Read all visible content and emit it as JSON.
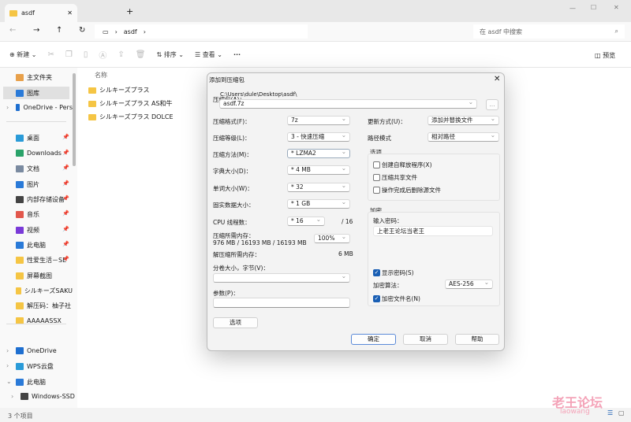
{
  "window": {
    "tab_title": "asdf",
    "new_tab": "+",
    "min": "—",
    "max": "☐",
    "close": "✕"
  },
  "address": {
    "crumb": "asdf",
    "search_placeholder": "在 asdf 中搜索"
  },
  "toolbar": {
    "new": "新建",
    "sort": "排序",
    "view": "查看",
    "more": "···",
    "preview": "预览"
  },
  "sidebar": {
    "items": [
      {
        "label": "主文件夹",
        "icon": "home-icon",
        "color": "#e8a04a"
      },
      {
        "label": "图库",
        "icon": "gallery-icon",
        "color": "#2a7ad8"
      },
      {
        "label": "OneDrive - Pers",
        "icon": "cloud-icon",
        "color": "#1e6fd0"
      },
      {
        "label": "桌面",
        "icon": "desktop-icon",
        "color": "#2a9bd8",
        "pin": true
      },
      {
        "label": "Downloads",
        "icon": "download-icon",
        "color": "#2aa36a",
        "pin": true
      },
      {
        "label": "文档",
        "icon": "document-icon",
        "color": "#7a8aa0",
        "pin": true
      },
      {
        "label": "图片",
        "icon": "picture-icon",
        "color": "#2a7ad8",
        "pin": true
      },
      {
        "label": "内部存储设备",
        "icon": "drive-icon",
        "color": "#444",
        "pin": true
      },
      {
        "label": "音乐",
        "icon": "music-icon",
        "color": "#e2574c",
        "pin": true
      },
      {
        "label": "视频",
        "icon": "video-icon",
        "color": "#7a3ad8",
        "pin": true
      },
      {
        "label": "此电脑",
        "icon": "computer-icon",
        "color": "#2a7ad8",
        "pin": true
      },
      {
        "label": "性爱生活－SE",
        "icon": "folder-icon",
        "color": "#f5c544",
        "pin": true
      },
      {
        "label": "屏幕截图",
        "icon": "folder-icon",
        "color": "#f5c544"
      },
      {
        "label": "シルキーズSAKU",
        "icon": "folder-icon",
        "color": "#f5c544"
      },
      {
        "label": "解压码：柚子社",
        "icon": "folder-icon",
        "color": "#f5c544"
      },
      {
        "label": "AAAAASSX",
        "icon": "folder-icon",
        "color": "#f5c544"
      },
      {
        "label": "OneDrive",
        "icon": "cloud-icon",
        "color": "#1e6fd0"
      },
      {
        "label": "WPS云盘",
        "icon": "cloud-icon",
        "color": "#2a9bd8"
      },
      {
        "label": "此电脑",
        "icon": "computer-icon",
        "color": "#2a7ad8"
      },
      {
        "label": "Windows-SSD",
        "icon": "drive-icon",
        "color": "#444"
      }
    ]
  },
  "files": {
    "header": "名称",
    "items": [
      "シルキーズプラス",
      "シルキーズプラス AS和牛",
      "シルキーズプラス DOLCE"
    ]
  },
  "status": "3 个项目",
  "dialog": {
    "title": "添加到压缩包",
    "close": "✕",
    "archive_label": "压缩包(A)：",
    "archive_path": "C:\\Users\\dule\\Desktop\\asdf\\",
    "archive_name": "asdf.7z",
    "browse": "...",
    "left": [
      {
        "label": "压缩格式(F)：",
        "value": "7z"
      },
      {
        "label": "压缩等级(L)：",
        "value": "3 - 快速压缩"
      },
      {
        "label": "压缩方法(M)：",
        "value": "* LZMA2"
      },
      {
        "label": "字典大小(D)：",
        "value": "* 4 MB"
      },
      {
        "label": "单词大小(W)：",
        "value": "* 32"
      },
      {
        "label": "固实数据大小：",
        "value": "* 1 GB"
      }
    ],
    "cpu": {
      "label": "CPU 线程数：",
      "value": "* 16",
      "max": "/ 16"
    },
    "mem": {
      "label": "压缩所需内存：",
      "detail": "976 MB / 16193 MB / 16193 MB",
      "value": "100%"
    },
    "decomp": {
      "label": "解压缩所需内存：",
      "value": "6 MB"
    },
    "volume": {
      "label": "分卷大小，字节(V)：",
      "value": ""
    },
    "params": {
      "label": "参数(P)：",
      "value": ""
    },
    "options_button": "选项",
    "update": {
      "label": "更新方式(U)：",
      "value": "添加并替换文件"
    },
    "pathmode": {
      "label": "路径模式",
      "value": "相对路径"
    },
    "options": {
      "title": "选项",
      "items": [
        {
          "label": "创建自释放程序(X)",
          "checked": false
        },
        {
          "label": "压缩共享文件",
          "checked": false
        },
        {
          "label": "操作完成后删除源文件",
          "checked": false
        }
      ]
    },
    "encrypt": {
      "title": "加密",
      "pw_label": "输入密码：",
      "password": "上老王论坛当老王",
      "show_pw": {
        "label": "显示密码(S)",
        "checked": true
      },
      "method_label": "加密算法：",
      "method": "AES-256",
      "enc_names": {
        "label": "加密文件名(N)",
        "checked": true
      }
    },
    "ok": "确定",
    "cancel": "取消",
    "help": "帮助"
  },
  "watermark": {
    "cn": "老王论坛",
    "en": "laowang"
  }
}
